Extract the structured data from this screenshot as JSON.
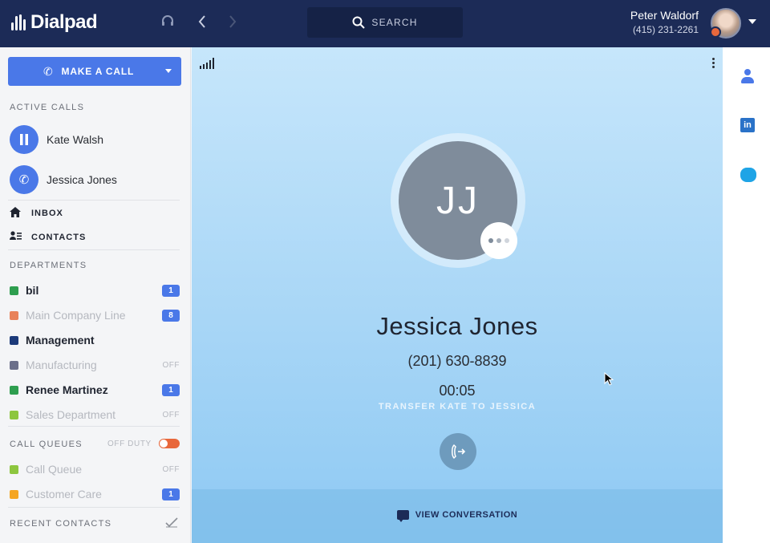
{
  "app": {
    "logo_text": "Dialpad"
  },
  "search": {
    "label": "SEARCH"
  },
  "user": {
    "name": "Peter Waldorf",
    "phone": "(415) 231-2261"
  },
  "sidebar": {
    "make_call_label": "MAKE A CALL",
    "active_calls_header": "ACTIVE CALLS",
    "active_calls": [
      {
        "name": "Kate Walsh",
        "state": "pause-icon"
      },
      {
        "name": "Jessica Jones",
        "state": "phone-icon"
      }
    ],
    "nav": [
      {
        "label": "INBOX",
        "icon": "home-icon"
      },
      {
        "label": "CONTACTS",
        "icon": "contacts-icon"
      }
    ],
    "departments_header": "DEPARTMENTS",
    "departments": [
      {
        "name": "bil",
        "color": "#2e9e4f",
        "badge": "1",
        "active": true
      },
      {
        "name": "Main Company Line",
        "color": "#e8825a",
        "badge": "8",
        "active": false
      },
      {
        "name": "Management",
        "color": "#1c3a7a",
        "badge": "",
        "active": true
      },
      {
        "name": "Manufacturing",
        "color": "#6b6f8a",
        "badge": "OFF",
        "active": false
      },
      {
        "name": "Renee Martinez",
        "color": "#2e9e4f",
        "badge": "1",
        "active": true
      },
      {
        "name": "Sales Department",
        "color": "#8dc63f",
        "badge": "OFF",
        "active": false
      }
    ],
    "call_queues_header": "CALL QUEUES",
    "off_duty_label": "OFF DUTY",
    "call_queues": [
      {
        "name": "Call Queue",
        "color": "#8dc63f",
        "badge": "OFF"
      },
      {
        "name": "Customer Care",
        "color": "#f5a623",
        "badge": "1"
      }
    ],
    "recent_contacts_header": "RECENT CONTACTS"
  },
  "call": {
    "initials": "JJ",
    "name": "Jessica Jones",
    "phone": "(201) 630-8839",
    "timer": "00:05",
    "transfer_label": "TRANSFER KATE TO JESSICA",
    "view_conversation_label": "VIEW CONVERSATION"
  },
  "rail": {
    "linkedin_glyph": "in"
  },
  "colors": {
    "topbar": "#1c2b57",
    "accent": "#4a78e8",
    "toggle_off": "#e8683c"
  }
}
